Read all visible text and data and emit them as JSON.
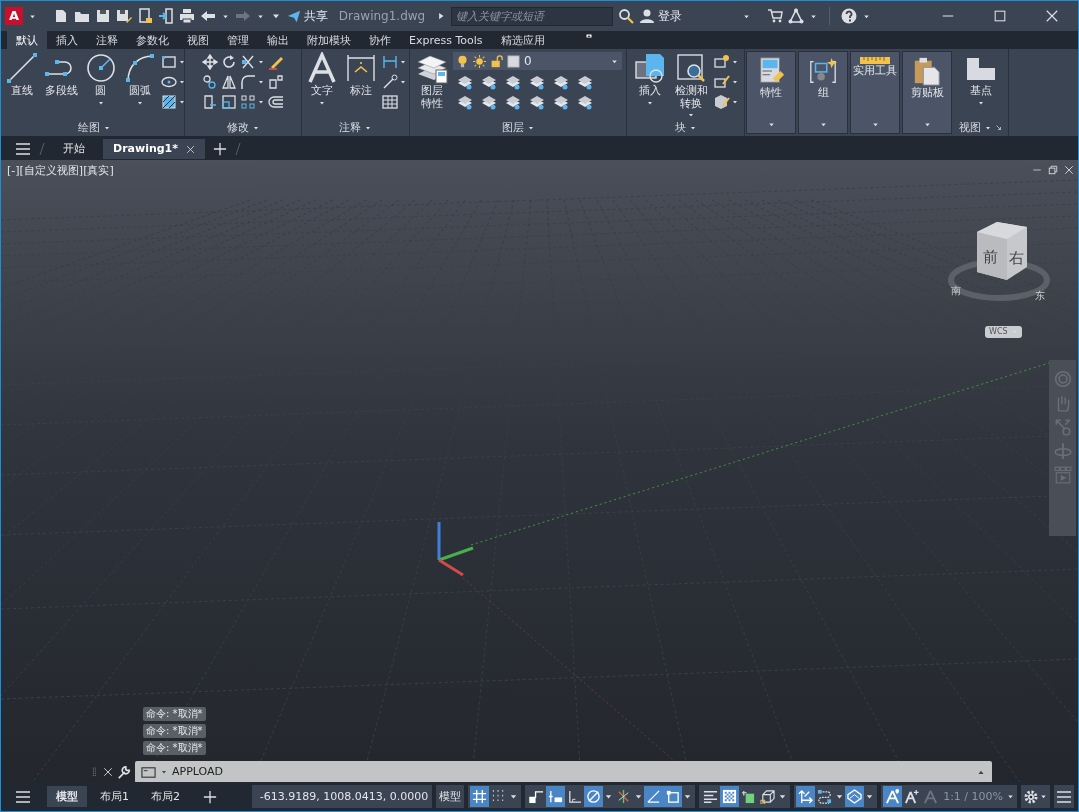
{
  "title_bar": {
    "logo": "A",
    "share": "共享",
    "title": "Drawing1.dwg",
    "search": {
      "placeholder": "键入关键字或短语"
    },
    "user": "登录"
  },
  "ribbon_tabs": [
    {
      "label": "默认",
      "selected": true
    },
    {
      "label": "插入",
      "selected": false
    },
    {
      "label": "注释",
      "selected": false
    },
    {
      "label": "参数化",
      "selected": false
    },
    {
      "label": "视图",
      "selected": false
    },
    {
      "label": "管理",
      "selected": false
    },
    {
      "label": "输出",
      "selected": false
    },
    {
      "label": "附加模块",
      "selected": false
    },
    {
      "label": "协作",
      "selected": false
    },
    {
      "label": "Express Tools",
      "selected": false
    },
    {
      "label": "精选应用",
      "selected": false
    }
  ],
  "ribbon_panels": [
    {
      "kind": "tools",
      "title": "绘图",
      "tools": [
        {
          "label": "直线",
          "dropdown": false
        },
        {
          "label": "多段线",
          "dropdown": false
        },
        {
          "label": "圆",
          "dropdown": true
        },
        {
          "label": "圆弧",
          "dropdown": true
        }
      ]
    },
    {
      "kind": "tools",
      "title": "修改"
    },
    {
      "kind": "tools",
      "title": "注释",
      "tools": [
        {
          "label": "文字",
          "dropdown": true
        },
        {
          "label": "标注",
          "dropdown": false
        }
      ]
    },
    {
      "kind": "layers",
      "title": "图层",
      "tools": [
        {
          "label": "图层特性",
          "dropdown": false
        }
      ],
      "current_layer": "0"
    },
    {
      "kind": "tools",
      "title": "块",
      "tools": [
        {
          "label": "插入",
          "dropdown": true
        },
        {
          "label": "检测和转换",
          "dropdown": true
        }
      ]
    },
    {
      "kind": "collapsed",
      "title": "特性"
    },
    {
      "kind": "collapsed",
      "title": "组"
    },
    {
      "kind": "collapsed",
      "title": "实用工具"
    },
    {
      "kind": "collapsed",
      "title": "剪贴板"
    },
    {
      "kind": "tools",
      "title": "视图",
      "tools": [
        {
          "label": "基点",
          "dropdown": true
        }
      ],
      "launcher": true
    }
  ],
  "file_tabs": [
    {
      "label": "开始",
      "selected": false
    },
    {
      "label": "Drawing1*",
      "selected": true
    }
  ],
  "viewport": {
    "label": "[-][自定义视图][真实]",
    "cube_faces": [
      "前",
      "右"
    ],
    "compass": [
      "南",
      "东"
    ],
    "ucs_menu": "WCS"
  },
  "command": {
    "history": [
      "命令: *取消*",
      "命令: *取消*",
      "命令: *取消*"
    ],
    "input": "APPLOAD"
  },
  "layout_tabs": [
    {
      "label": "模型",
      "selected": true
    },
    {
      "label": "布局1",
      "selected": false
    },
    {
      "label": "布局2",
      "selected": false
    }
  ],
  "status_bar": {
    "coordinates": "-613.9189, 1008.0413, 0.0000",
    "space": "模型",
    "scale": "1:1 / 100%",
    "toggles": [
      {
        "on": true,
        "dropdown": false
      },
      {
        "on": false,
        "dropdown": true
      },
      {
        "on": false,
        "dropdown": false
      },
      {
        "on": true,
        "dropdown": false
      },
      {
        "on": false,
        "dropdown": false
      },
      {
        "on": true,
        "dropdown": true
      },
      {
        "on": false,
        "dropdown": true
      },
      {
        "on": true,
        "dropdown": false
      },
      {
        "on": true,
        "dropdown": true
      },
      {
        "on": false,
        "dropdown": false
      },
      {
        "on": true,
        "dropdown": false
      },
      {
        "on": false,
        "dropdown": false
      },
      {
        "on": false,
        "dropdown": true
      },
      {
        "on": true,
        "dropdown": false
      },
      {
        "on": false,
        "dropdown": true
      },
      {
        "on": true,
        "dropdown": true
      },
      {
        "on": true,
        "dropdown": false
      },
      {
        "on": false,
        "dropdown": false
      },
      {
        "on": false,
        "dropdown": false
      }
    ]
  }
}
